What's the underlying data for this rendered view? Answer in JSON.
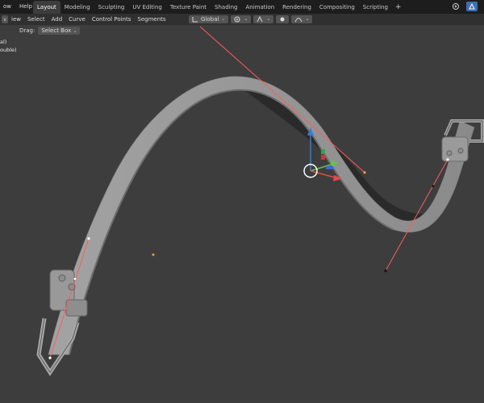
{
  "menu": {
    "items": [
      {
        "label": "ow",
        "x": 1
      },
      {
        "label": "Help",
        "x": 14
      }
    ]
  },
  "workspace_tabs": [
    {
      "label": "Layout",
      "active": true
    },
    {
      "label": "Modeling",
      "active": false
    },
    {
      "label": "Sculpting",
      "active": false
    },
    {
      "label": "UV Editing",
      "active": false
    },
    {
      "label": "Texture Paint",
      "active": false
    },
    {
      "label": "Shading",
      "active": false
    },
    {
      "label": "Animation",
      "active": false
    },
    {
      "label": "Rendering",
      "active": false
    },
    {
      "label": "Compositing",
      "active": false
    },
    {
      "label": "Scripting",
      "active": false
    }
  ],
  "tab_add_label": "+",
  "header": {
    "mode_toggle": "v",
    "menus": [
      "iew",
      "Select",
      "Add",
      "Curve",
      "Control Points",
      "Segments"
    ],
    "drag_label": "Drag:",
    "drag_value": "Select Box",
    "transform_orientation": "Global"
  },
  "overlay": {
    "line1": "al)",
    "line2": "ouble)"
  },
  "colors": {
    "background": "#3d3d3d",
    "topbar": "#1d1d1d",
    "header": "#303030",
    "belt": "#9a9a9a",
    "handle_line": "#ff4d4d",
    "gizmo_z": "#3a7bd5",
    "gizmo_y": "#6cc04a",
    "gizmo_x": "#e04a4a"
  },
  "icons": [
    "pivot-icon",
    "snap-icon",
    "proportional-icon",
    "falloff-icon",
    "overlay-icon",
    "shading-icon"
  ]
}
